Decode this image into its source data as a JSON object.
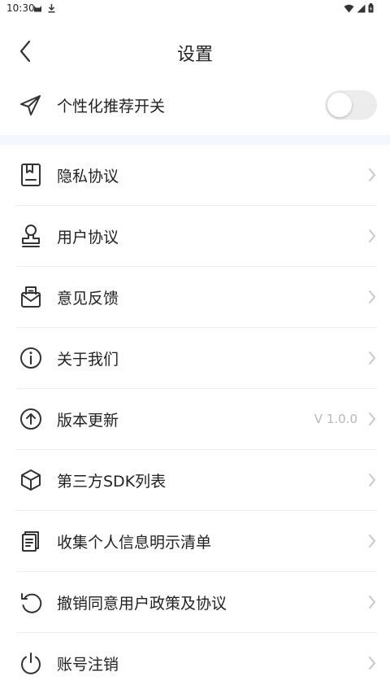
{
  "status_bar": {
    "time": "10:30"
  },
  "header": {
    "title": "设置"
  },
  "recommend": {
    "label": "个性化推荐开关",
    "enabled": false,
    "icon": "paper-plane-icon"
  },
  "colors": {
    "section_gap": "#f4f7fd",
    "toggle_off": "#ececec",
    "divider": "#eeeeee",
    "chevron": "#c8c8c8",
    "value_text": "#b8b8b8"
  },
  "items": [
    {
      "label": "隐私协议",
      "icon": "privacy-doc-icon"
    },
    {
      "label": "用户协议",
      "icon": "stamp-icon"
    },
    {
      "label": "意见反馈",
      "icon": "feedback-mail-icon"
    },
    {
      "label": "关于我们",
      "icon": "info-icon"
    },
    {
      "label": "版本更新",
      "icon": "upload-arrow-icon",
      "value": "V 1.0.0"
    },
    {
      "label": "第三方SDK列表",
      "icon": "cube-icon"
    },
    {
      "label": "收集个人信息明示清单",
      "icon": "document-list-icon"
    },
    {
      "label": "撤销同意用户政策及协议",
      "icon": "undo-icon"
    },
    {
      "label": "账号注销",
      "icon": "power-icon"
    }
  ]
}
